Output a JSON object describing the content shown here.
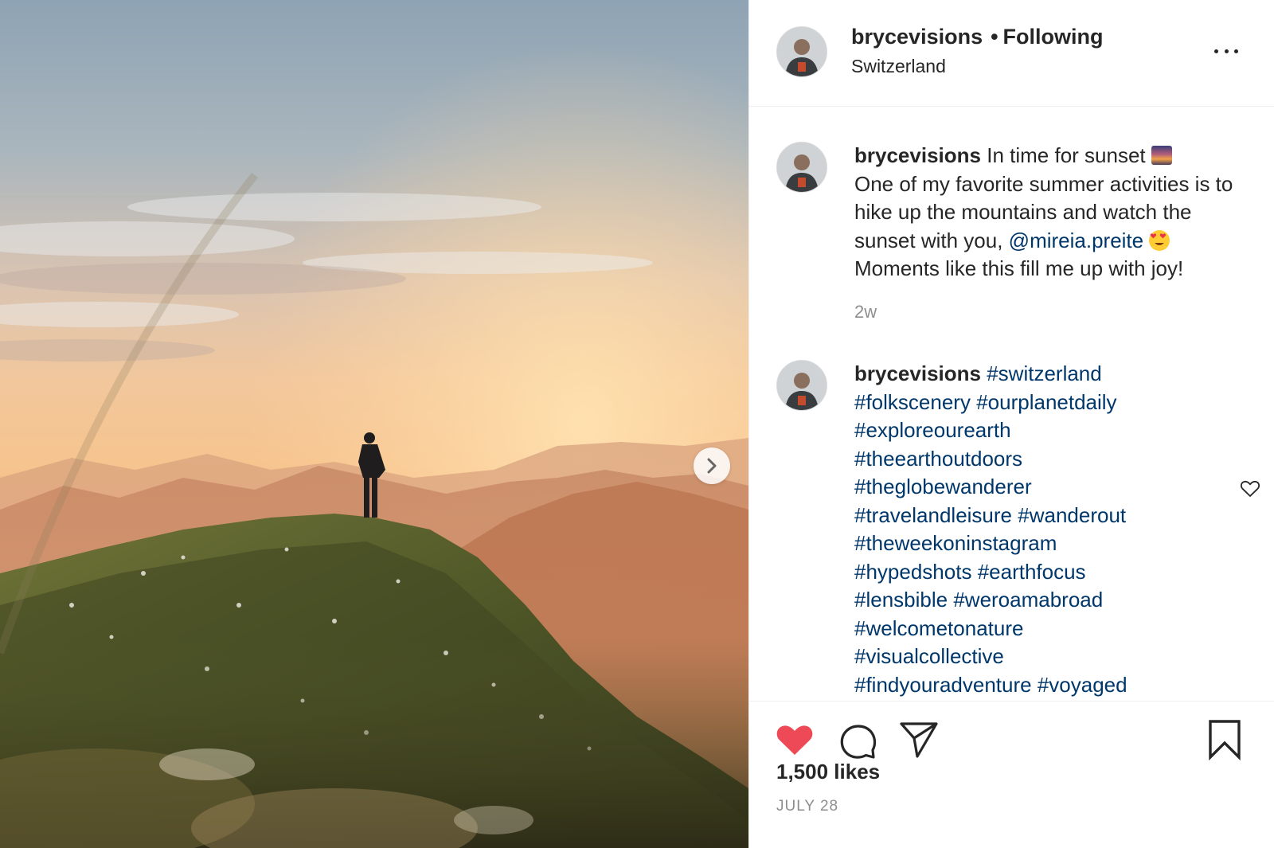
{
  "post": {
    "author": "brycevisions",
    "following_label": "Following",
    "location": "Switzerland",
    "caption": {
      "author": "brycevisions",
      "text_1": "In time for sunset",
      "emoji_1": "sunset-emoji",
      "text_2": "One of my favorite summer activities is to hike up the mountains and watch the sunset with you,",
      "mention": "@mireia.preite",
      "emoji_2": "heart-eyes-emoji",
      "text_3": "Moments like this fill me up with joy!",
      "time": "2w"
    },
    "hashtag_comment": {
      "author": "brycevisions",
      "tags": [
        "#switzerland",
        "#folkscenery",
        "#ourplanetdaily",
        "#exploreourearth",
        "#theearthoutdoors",
        "#theglobewanderer",
        "#travelandleisure",
        "#wanderout",
        "#theweekoninstagram",
        "#hypedshots",
        "#earthfocus",
        "#lensbible",
        "#weroamabroad",
        "#welcometonature",
        "#visualcollective",
        "#findyouradventure",
        "#voyaged"
      ]
    },
    "likes": "1,500 likes",
    "date": "JULY 28"
  },
  "icons": {
    "like": "heart-filled-icon",
    "comment": "comment-bubble-icon",
    "share": "paper-plane-icon",
    "save": "bookmark-icon",
    "more": "ellipsis-icon",
    "next": "chevron-right-icon",
    "comment_like": "heart-outline-icon"
  },
  "colors": {
    "like_red": "#ed4956",
    "link_blue": "#00376b",
    "muted_gray": "#8e8e8e",
    "text": "#262626"
  }
}
